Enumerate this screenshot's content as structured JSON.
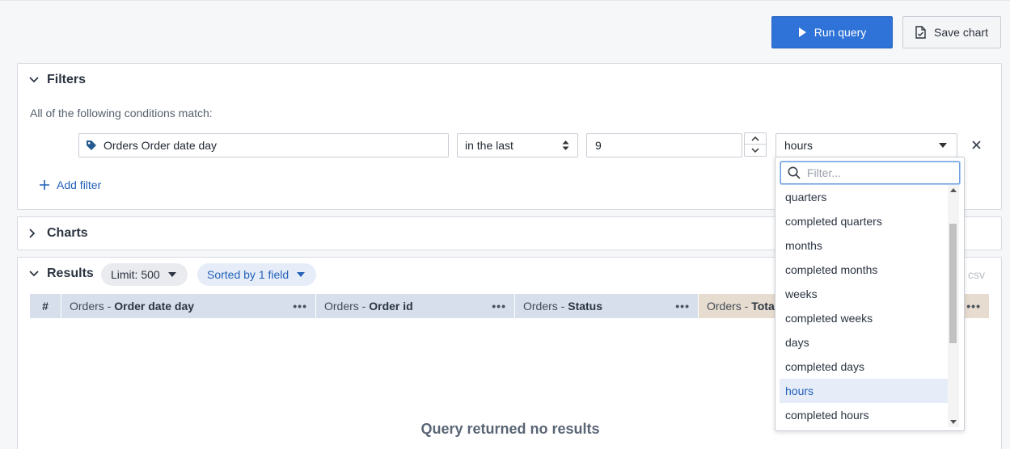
{
  "toolbar": {
    "run_label": "Run query",
    "save_label": "Save chart"
  },
  "filters": {
    "title": "Filters",
    "conditions_text": "All of the following conditions match:",
    "row": {
      "field": "Orders Order date day",
      "operator": "in the last",
      "value": "9",
      "unit": "hours"
    },
    "add_label": "Add filter"
  },
  "charts": {
    "title": "Charts"
  },
  "results": {
    "title": "Results",
    "limit_label": "Limit: 500",
    "sort_label": "Sorted by 1 field",
    "csv_label": "csv",
    "columns": [
      {
        "index": "#"
      },
      {
        "prefix": "Orders - ",
        "name": "Order date day"
      },
      {
        "prefix": "Orders - ",
        "name": "Order id"
      },
      {
        "prefix": "Orders - ",
        "name": "Status"
      },
      {
        "prefix": "Orders - ",
        "name": "Tota"
      }
    ],
    "empty_title": "Query returned no results",
    "empty_sub": ""
  },
  "dropdown": {
    "search_placeholder": "Filter...",
    "options": [
      "quarters",
      "completed quarters",
      "months",
      "completed months",
      "weeks",
      "completed weeks",
      "days",
      "completed days",
      "hours",
      "completed hours"
    ],
    "selected": "hours"
  },
  "colors": {
    "accent": "#2f73d8",
    "link": "#2361b8",
    "header_blue": "#d6dfeb",
    "header_tan": "#e6dccf"
  }
}
